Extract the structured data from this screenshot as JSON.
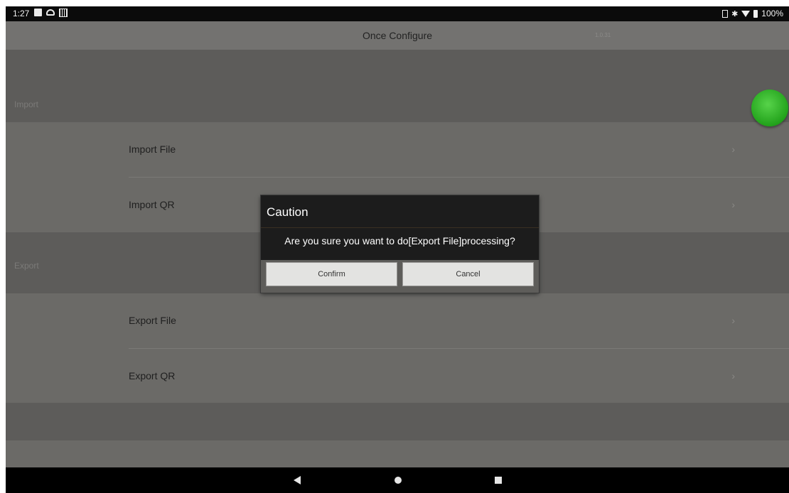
{
  "status_bar": {
    "time": "1:27",
    "battery": "100%",
    "bluetooth": "✱"
  },
  "header": {
    "title": "Once Configure",
    "version": "1.0.31"
  },
  "sections": {
    "import": {
      "label": "Import",
      "items": [
        {
          "label": "Import File",
          "chevron": "›"
        },
        {
          "label": "Import QR",
          "chevron": "›"
        }
      ]
    },
    "export": {
      "label": "Export",
      "items": [
        {
          "label": "Export File",
          "chevron": "›"
        },
        {
          "label": "Export QR",
          "chevron": "›"
        }
      ]
    }
  },
  "dialog": {
    "title": "Caution",
    "message": "Are you sure you want to do[Export File]processing?",
    "confirm_label": "Confirm",
    "cancel_label": "Cancel"
  },
  "colors": {
    "fab": "#2fb82a",
    "dialog_bg": "#1c1c1c",
    "overlay_bg": "#6b6a67"
  },
  "icons": {
    "nav_back": "back-triangle-icon",
    "nav_home": "home-circle-icon",
    "nav_recent": "recents-square-icon"
  }
}
